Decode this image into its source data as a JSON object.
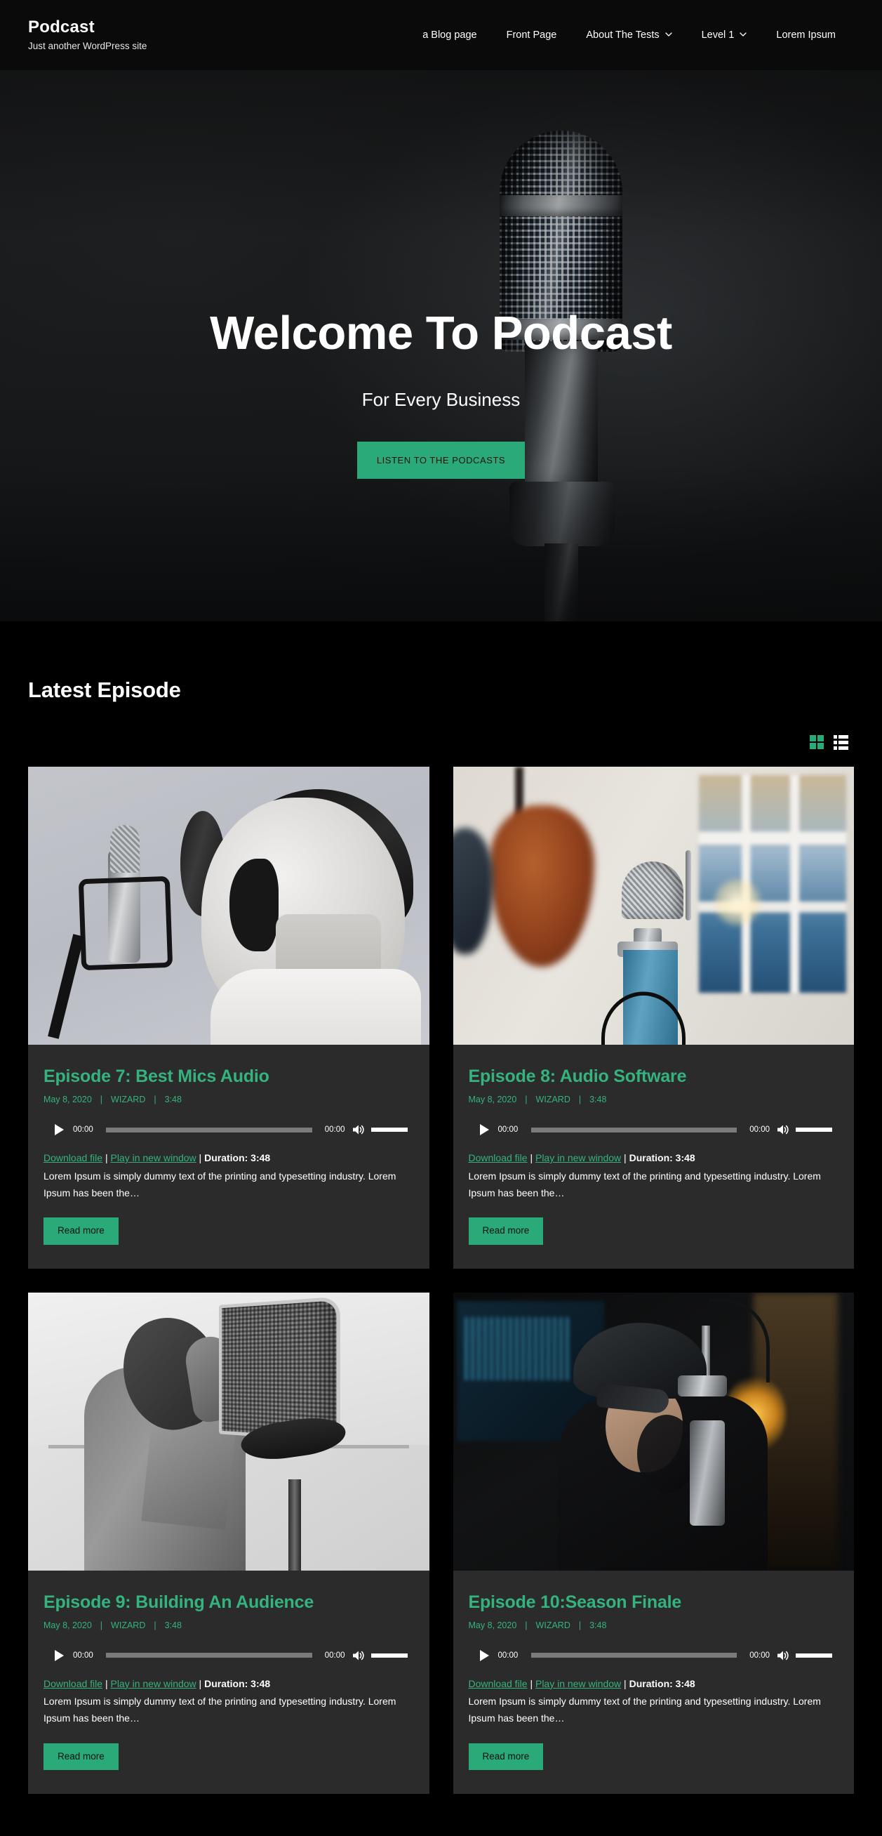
{
  "colors": {
    "accent_green": "#2aa979",
    "title_green": "#35b37e",
    "page_background": "#000000",
    "card_background": "#2b2b2b",
    "header_background": "#0a0a0a"
  },
  "header": {
    "brand_title": "Podcast",
    "brand_tagline": "Just another WordPress site",
    "nav": [
      {
        "label": "a Blog page",
        "has_dropdown": false
      },
      {
        "label": "Front Page",
        "has_dropdown": false
      },
      {
        "label": "About The Tests",
        "has_dropdown": true
      },
      {
        "label": "Level 1",
        "has_dropdown": true
      },
      {
        "label": "Lorem Ipsum",
        "has_dropdown": false
      }
    ]
  },
  "hero": {
    "title": "Welcome To Podcast",
    "subtitle": "For Every Business",
    "cta_label": "LISTEN TO THE PODCASTS",
    "image_alt": "studio-condenser-microphone"
  },
  "episodes_section": {
    "title": "Latest Episode",
    "view_toggle": {
      "grid_label": "grid-view",
      "list_label": "list-view",
      "active": "grid"
    },
    "cards": [
      {
        "title": "Episode 7: Best Mics Audio",
        "date": "May 8, 2020",
        "author": "WIZARD",
        "length": "3:48",
        "player": {
          "current_time": "00:00",
          "total_time": "00:00",
          "play_label": "play"
        },
        "download_label": "Download file",
        "new_window_label": "Play in new window",
        "duration_label": "Duration: 3:48",
        "excerpt": "Lorem Ipsum is simply dummy text of the printing and typesetting industry. Lorem Ipsum has been the…",
        "read_more_label": "Read more",
        "image_alt": "boy-shouting-into-microphone"
      },
      {
        "title": "Episode 8: Audio Software",
        "date": "May 8, 2020",
        "author": "WIZARD",
        "length": "3:48",
        "player": {
          "current_time": "00:00",
          "total_time": "00:00",
          "play_label": "play"
        },
        "download_label": "Download file",
        "new_window_label": "Play in new window",
        "duration_label": "Duration: 3:48",
        "excerpt": "Lorem Ipsum is simply dummy text of the printing and typesetting industry. Lorem Ipsum has been the…",
        "read_more_label": "Read more",
        "image_alt": "blue-condenser-microphone-with-guitars"
      },
      {
        "title": "Episode 9: Building An Audience",
        "date": "May 8, 2020",
        "author": "WIZARD",
        "length": "3:48",
        "player": {
          "current_time": "00:00",
          "total_time": "00:00",
          "play_label": "play"
        },
        "download_label": "Download file",
        "new_window_label": "Play in new window",
        "duration_label": "Duration: 3:48",
        "excerpt": "Lorem Ipsum is simply dummy text of the printing and typesetting industry. Lorem Ipsum has been the…",
        "read_more_label": "Read more",
        "image_alt": "man-singing-behind-pop-filter"
      },
      {
        "title": "Episode 10:Season Finale",
        "date": "May 8, 2020",
        "author": "WIZARD",
        "length": "3:48",
        "player": {
          "current_time": "00:00",
          "total_time": "00:00",
          "play_label": "play"
        },
        "download_label": "Download file",
        "new_window_label": "Play in new window",
        "duration_label": "Duration: 3:48",
        "excerpt": "Lorem Ipsum is simply dummy text of the printing and typesetting industry. Lorem Ipsum has been the…",
        "read_more_label": "Read more",
        "image_alt": "man-in-cap-recording-in-dark-studio"
      }
    ]
  }
}
